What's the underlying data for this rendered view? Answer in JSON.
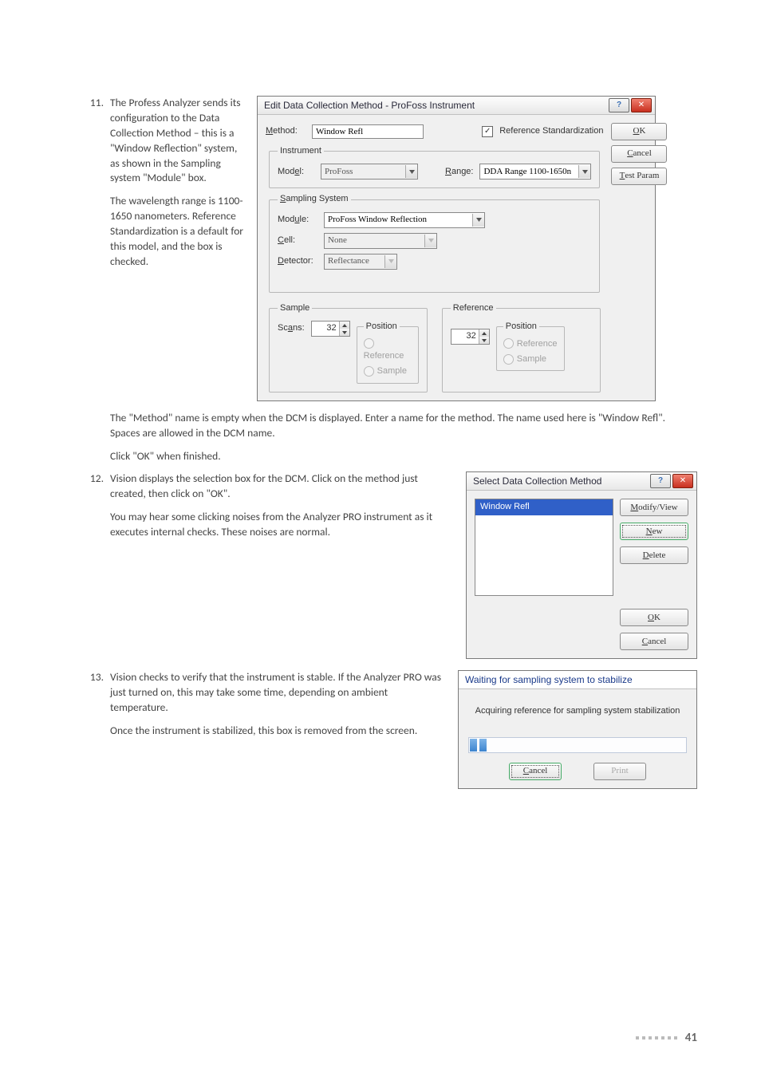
{
  "steps": {
    "s11_num": "11.",
    "s11_p1": "The Profess Analyzer sends its configuration to the Data Collection Method – this is a \"Window Reflection\" system, as shown in the Sampling system \"Module\" box.",
    "s11_p2": "The wavelength range is 1100-1650 nanometers. Reference Standardization is a default for this model, and the box is checked.",
    "s11_after1": "The \"Method\" name is empty when the DCM is displayed. Enter a name for the method. The name used here is \"Window Refl\". Spaces are allowed in the DCM name.",
    "s11_after2": "Click \"OK\" when finished.",
    "s12_num": "12.",
    "s12_p1": "Vision displays the selection box for the DCM. Click on the method just created, then click on \"OK\".",
    "s12_p2": "You may hear some clicking noises from the Analyzer PRO instrument as it executes internal checks. These noises are normal.",
    "s13_num": "13.",
    "s13_p1": "Vision checks to verify that the instrument is stable. If the Analyzer PRO was just turned on, this may take some time, depending on ambient temperature.",
    "s13_p2": "Once the instrument is stabilized, this box is removed from the screen."
  },
  "dlg1": {
    "title": "Edit Data Collection Method - ProFoss Instrument",
    "method_label": "Method:",
    "method_value": "Window Refl",
    "refstd_label": "Reference Standardization",
    "ok": "OK",
    "cancel": "Cancel",
    "testparam": "Test Param",
    "instrument_legend": "Instrument",
    "model_label": "Model:",
    "model_value": "ProFoss",
    "range_label": "Range:",
    "range_value": "DDA Range 1100-1650n",
    "sampling_legend": "Sampling System",
    "module_label": "Module:",
    "module_value": "ProFoss Window Reflection",
    "cell_label": "Cell:",
    "cell_value": "None",
    "detector_label": "Detector:",
    "detector_value": "Reflectance",
    "sample_legend": "Sample",
    "reference_legend": "Reference",
    "scans_label": "Scans:",
    "scans_value": "32",
    "ref_scans_value": "32",
    "position_legend": "Position",
    "pos_reference": "Reference",
    "pos_sample": "Sample"
  },
  "dlg2": {
    "title": "Select Data Collection Method",
    "item": "Window Refl",
    "modify": "Modify/View",
    "new": "New",
    "delete": "Delete",
    "ok": "OK",
    "cancel": "Cancel"
  },
  "dlg3": {
    "title": "Waiting for sampling system to stabilize",
    "msg": "Acquiring reference for sampling system stabilization",
    "cancel": "Cancel",
    "print": "Print"
  },
  "page_number": "41"
}
